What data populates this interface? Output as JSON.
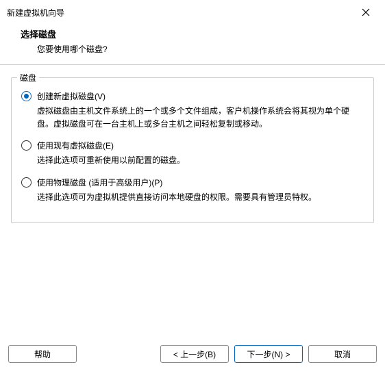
{
  "window": {
    "title": "新建虚拟机向导"
  },
  "header": {
    "title": "选择磁盘",
    "subtitle": "您要使用哪个磁盘?"
  },
  "group": {
    "label": "磁盘"
  },
  "options": {
    "create": {
      "label": "创建新虚拟磁盘(V)",
      "desc": "虚拟磁盘由主机文件系统上的一个或多个文件组成，客户机操作系统会将其视为单个硬盘。虚拟磁盘可在一台主机上或多台主机之间轻松复制或移动。",
      "selected": true
    },
    "existing": {
      "label": "使用现有虚拟磁盘(E)",
      "desc": "选择此选项可重新使用以前配置的磁盘。",
      "selected": false
    },
    "physical": {
      "label": "使用物理磁盘 (适用于高级用户)(P)",
      "desc": "选择此选项可为虚拟机提供直接访问本地硬盘的权限。需要具有管理员特权。",
      "selected": false
    }
  },
  "buttons": {
    "help": "帮助",
    "back": "< 上一步(B)",
    "next": "下一步(N) >",
    "cancel": "取消"
  }
}
